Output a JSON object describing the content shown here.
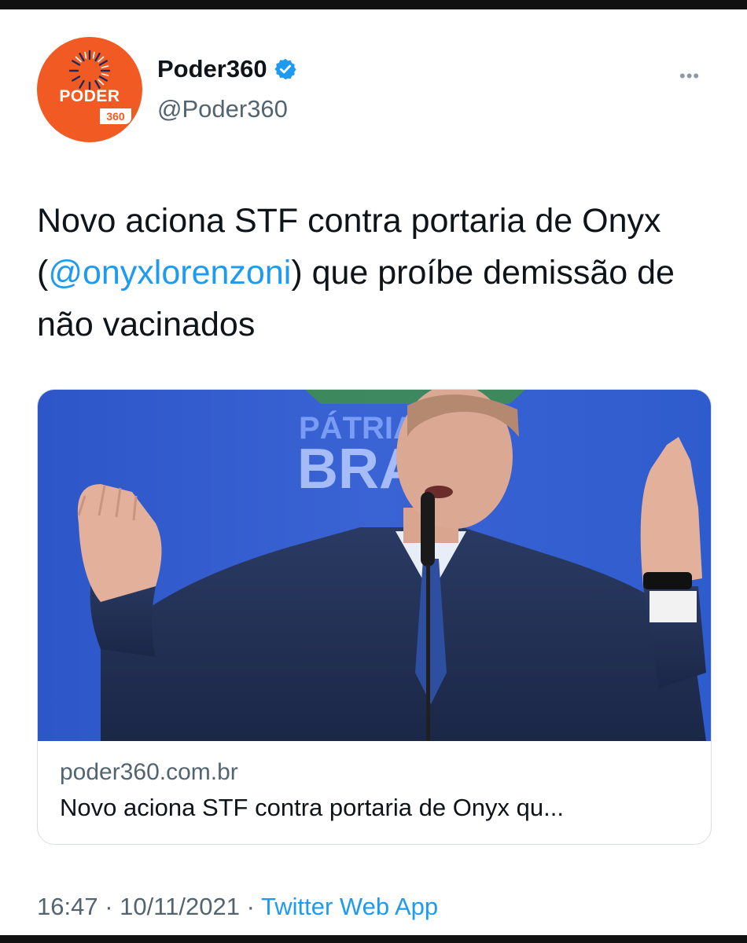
{
  "author": {
    "display_name": "Poder360",
    "handle": "@Poder360",
    "avatar_text": "PODER",
    "avatar_number": "360",
    "verified": true,
    "brand_color": "#f15a22"
  },
  "tweet": {
    "text_before": "Novo aciona STF contra portaria de Onyx (",
    "mention": "@onyxlorenzoni",
    "text_after": ") que proíbe demissão de não vacinados"
  },
  "card": {
    "image_text_line1": "PÁTRIA",
    "image_text_line2": "BRA",
    "domain": "poder360.com.br",
    "title": "Novo aciona STF contra portaria de Onyx qu..."
  },
  "meta": {
    "time": "16:47",
    "separator": " · ",
    "date": "10/11/2021",
    "source": "Twitter Web App"
  },
  "icons": {
    "more": "more-options-icon",
    "verified": "verified-badge-icon"
  },
  "colors": {
    "link": "#1d9bf0",
    "secondary_text": "#536471",
    "primary_text": "#0f1419"
  }
}
